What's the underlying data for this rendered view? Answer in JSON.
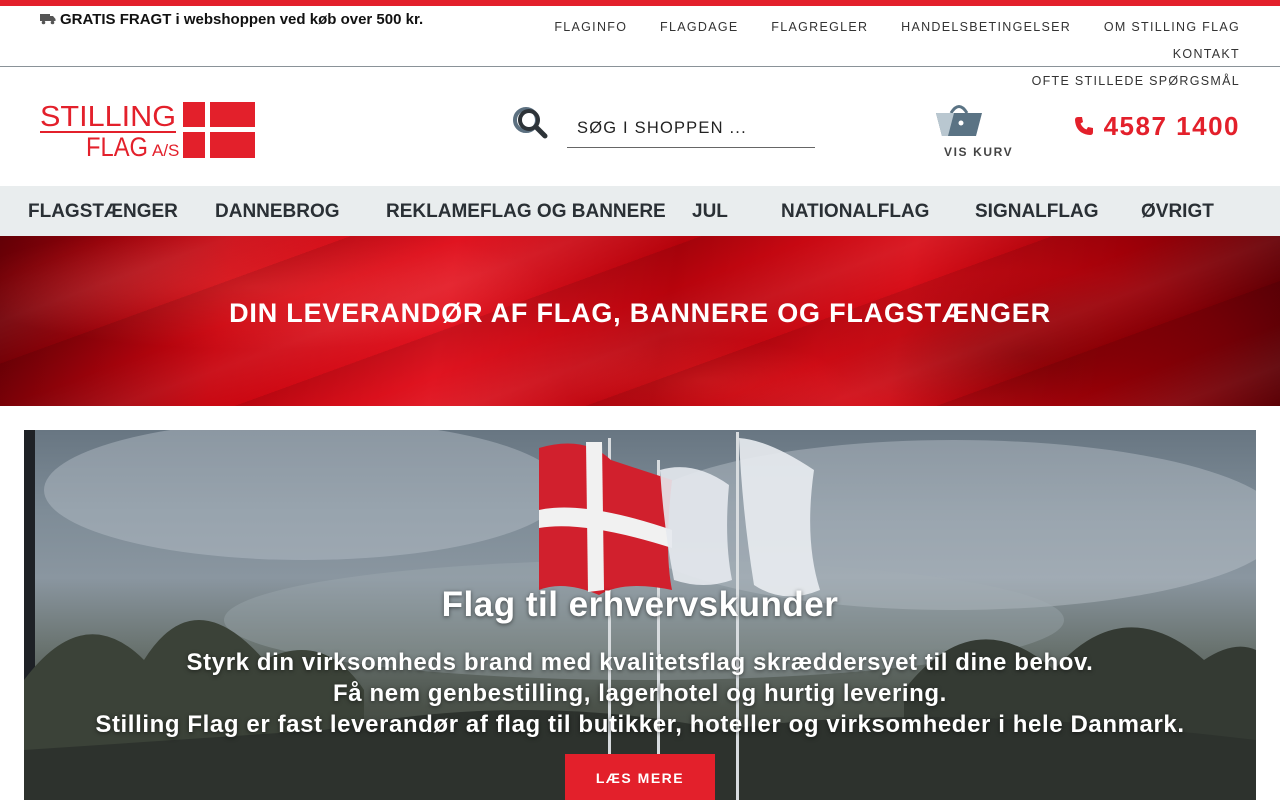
{
  "topbar": {
    "shipping_text": "GRATIS FRAGT i webshoppen ved køb over 500 kr.",
    "links": [
      "FLAGINFO",
      "FLAGDAGE",
      "FLAGREGLER",
      "HANDELSBETINGELSER",
      "OM STILLING FLAG",
      "KONTAKT",
      "OFTE STILLEDE SPØRGSMÅL"
    ]
  },
  "header": {
    "logo_text_line1": "STILLING",
    "logo_text_line2": "FLAG",
    "logo_text_suffix": "A/S",
    "search_placeholder": "SØG I SHOPPEN ...",
    "cart_label": "VIS KURV",
    "phone": "4587 1400"
  },
  "nav": {
    "items": [
      "FLAGSTÆNGER",
      "DANNEBROG",
      "REKLAMEFLAG OG BANNERE",
      "JUL",
      "NATIONALFLAG",
      "SIGNALFLAG",
      "ØVRIGT"
    ]
  },
  "hero": {
    "title": "DIN LEVERANDØR AF FLAG, BANNERE OG FLAGSTÆNGER"
  },
  "feature": {
    "title": "Flag til erhvervskunder",
    "lines": [
      "Styrk din virksomheds brand med kvalitetsflag skræddersyet til dine behov.",
      "Få nem genbestilling, lagerhotel og hurtig levering.",
      "Stilling Flag er fast leverandør af flag til butikker, hoteller og virksomheder i hele Danmark."
    ],
    "button_label": "LÆS MERE"
  },
  "colors": {
    "brand_red": "#e3202b",
    "nav_bg": "#e9edee",
    "cart_blue": "#5a7384"
  }
}
